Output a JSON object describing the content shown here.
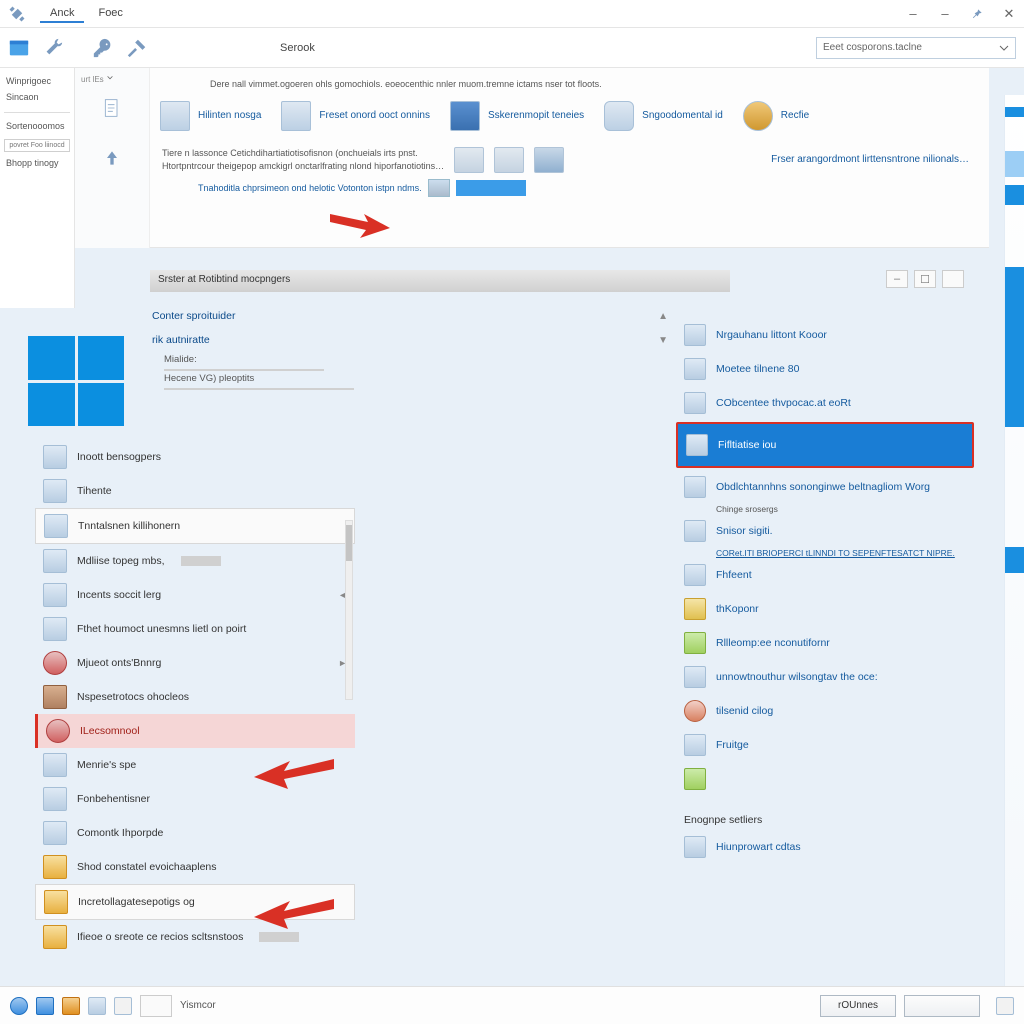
{
  "titlebar": {
    "tabs": [
      "Anck",
      "Foec"
    ],
    "active_tab": 0
  },
  "toolrow": {
    "breadcrumb": "Serook",
    "search_placeholder": "Eeet cosporons.taclne"
  },
  "leftnav": {
    "items": [
      "Winprigoec",
      "Sincaon",
      "Sortenooomos",
      "povret Foo liinocd",
      "Bhopp tinogy"
    ]
  },
  "mainupper": {
    "desc_line": "Dere nall vimmet.ogoeren ohls gomochiols. eoeocenthic nnler muom.tremne ictams nser tot floots.",
    "topicons": [
      {
        "label": "Hilinten nosga"
      },
      {
        "label": "Freset onord ooct onnins"
      },
      {
        "label": "Sskerenmopit teneies"
      },
      {
        "label": "Sngoodomental id"
      },
      {
        "label": "Recfie"
      }
    ],
    "sec_text1": "Tiere n lassonce Cetichdihartiatiotisofisnon (onchueials irts pnst.",
    "sec_text2": "Htortpntrcour theigepop amckigrl onctarlfrating nlond hiporfanotiotins…",
    "right_link": "Frser arangordmont lirttensntrone nilionals…",
    "third_text": "Tnahoditla chprsimeon ond helotic Votonton istpn ndms."
  },
  "section_header": "Srster at Rotibtind mocpngers",
  "centerinfo": {
    "rows": [
      {
        "label": "Conter sproituider",
        "tri": "▲"
      },
      {
        "label": "rik autniratte",
        "tri": "▼"
      }
    ],
    "meta1": "Mialide:",
    "meta2": "Hecene    VG) pleoptits"
  },
  "leftlist": {
    "items": [
      {
        "label": "Inoott bensogpers",
        "ic": "def"
      },
      {
        "label": "Tihente",
        "ic": "def"
      },
      {
        "label": "Tnntalsnen killihonern",
        "ic": "def",
        "box": true
      },
      {
        "label": "Mdliise topeg mbs,",
        "ic": "def",
        "bar": true
      },
      {
        "label": "Incents soccit lerg",
        "ic": "def",
        "arrow": "◄"
      },
      {
        "label": "Fthet houmoct unesmns lietl on poirt",
        "ic": "def"
      },
      {
        "label": "Mjueot onts'Bnnrg",
        "ic": "red",
        "arrow": "►"
      },
      {
        "label": "Nspesetrotocs ohocleos",
        "ic": "grn"
      },
      {
        "label": "ILecsomnool",
        "ic": "red",
        "sel": true
      },
      {
        "label": "Menrie's spe",
        "ic": "def"
      },
      {
        "label": "Fonbehentisner",
        "ic": "def"
      },
      {
        "label": "Comontk Ihporpde",
        "ic": "def"
      },
      {
        "label": "Shod constatel evoichaaplens",
        "ic": "yel"
      },
      {
        "label": "Incretollagatesepotigs og",
        "ic": "yel",
        "box": true
      },
      {
        "label": "Ifieoe o sreote ce recios scltsnstoos",
        "ic": "yel",
        "bar": true
      }
    ]
  },
  "rightlist": {
    "items": [
      {
        "label": "Nrgauhanu littont Kooor",
        "ic": "def"
      },
      {
        "label": "Moetee tilnene 80",
        "ic": "def"
      },
      {
        "label": "CObcentee thvpocac.at eoRt",
        "ic": "def"
      },
      {
        "label": "Fifltiatise iou",
        "ic": "def",
        "hl": true
      },
      {
        "label": "Obdlchtannhns sononginwe beltnagliom Worg",
        "ic": "def",
        "sub": "Chinge srosergs"
      },
      {
        "label": "Snisor sigiti.",
        "ic": "def",
        "sub_u": "CORet.ITI BRIOPERCI tLINNDI TO SEPENFTESATCT NIPRE."
      },
      {
        "label": "Fhfeent",
        "ic": "def"
      },
      {
        "label": "thKoponr",
        "ic": "yel"
      },
      {
        "label": "Rllleomp:ee nconutifornr",
        "ic": "grn"
      },
      {
        "label": "unnowtnouthur wilsongtav the oce:",
        "ic": "def"
      },
      {
        "label": "tilsenid cilog",
        "ic": "red"
      },
      {
        "label": "Fruitge",
        "ic": "def"
      },
      {
        "label": "",
        "ic": "grn"
      }
    ],
    "header2": "Enognpe setliers",
    "footer_item": "Hiunprowart cdtas"
  },
  "bottombar": {
    "label": "Yismcor",
    "ok": "rOUnnes",
    "cancel": ""
  }
}
